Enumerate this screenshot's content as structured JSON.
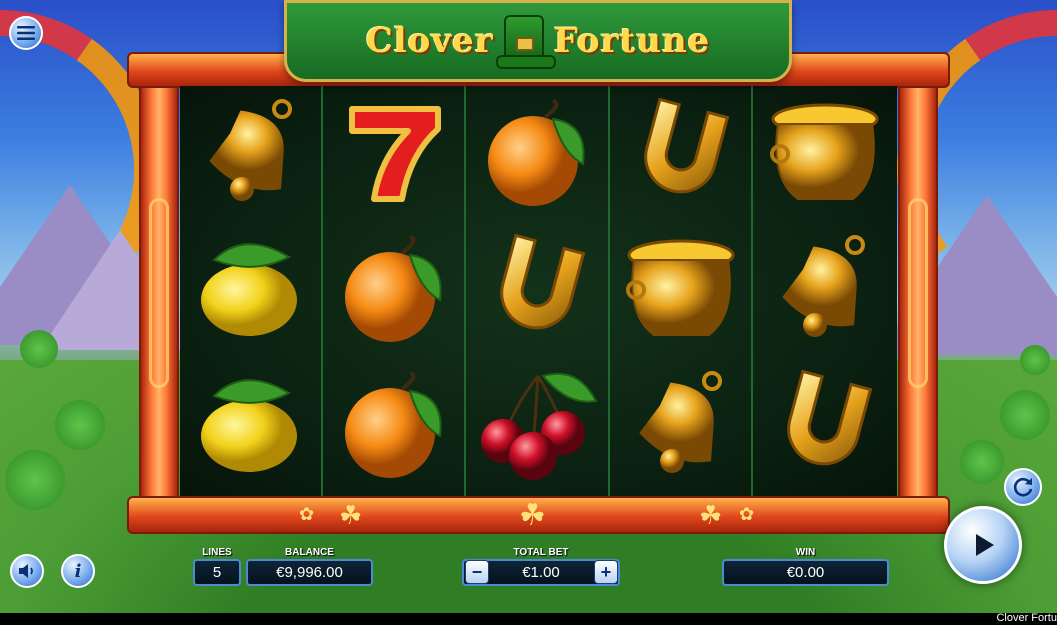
{
  "game": {
    "title_left": "Clover",
    "title_right": "Fortune",
    "footer_title": "Clover Fortu"
  },
  "reels": [
    [
      "bell",
      "lemon",
      "lemon"
    ],
    [
      "seven",
      "orange",
      "orange"
    ],
    [
      "orange",
      "horseshoe",
      "cherries"
    ],
    [
      "horseshoe",
      "pot-of-gold",
      "bell"
    ],
    [
      "pot-of-gold",
      "bell",
      "horseshoe"
    ]
  ],
  "controls": {
    "lines_label": "LINES",
    "lines_value": "5",
    "balance_label": "BALANCE",
    "balance_value": "€9,996.00",
    "total_bet_label": "TOTAL BET",
    "total_bet_value": "€1.00",
    "minus": "−",
    "plus": "+",
    "win_label": "WIN",
    "win_value": "€0.00",
    "info": "i"
  },
  "icons": {
    "menu": "hamburger-icon",
    "sound": "speaker-icon",
    "info": "info-icon",
    "autoplay": "refresh-icon",
    "spin": "play-icon"
  },
  "colors": {
    "frame": "#e0471c",
    "banner": "#176b22",
    "title_gold": "#ffd94a",
    "button_blue": "#4a86d6"
  }
}
